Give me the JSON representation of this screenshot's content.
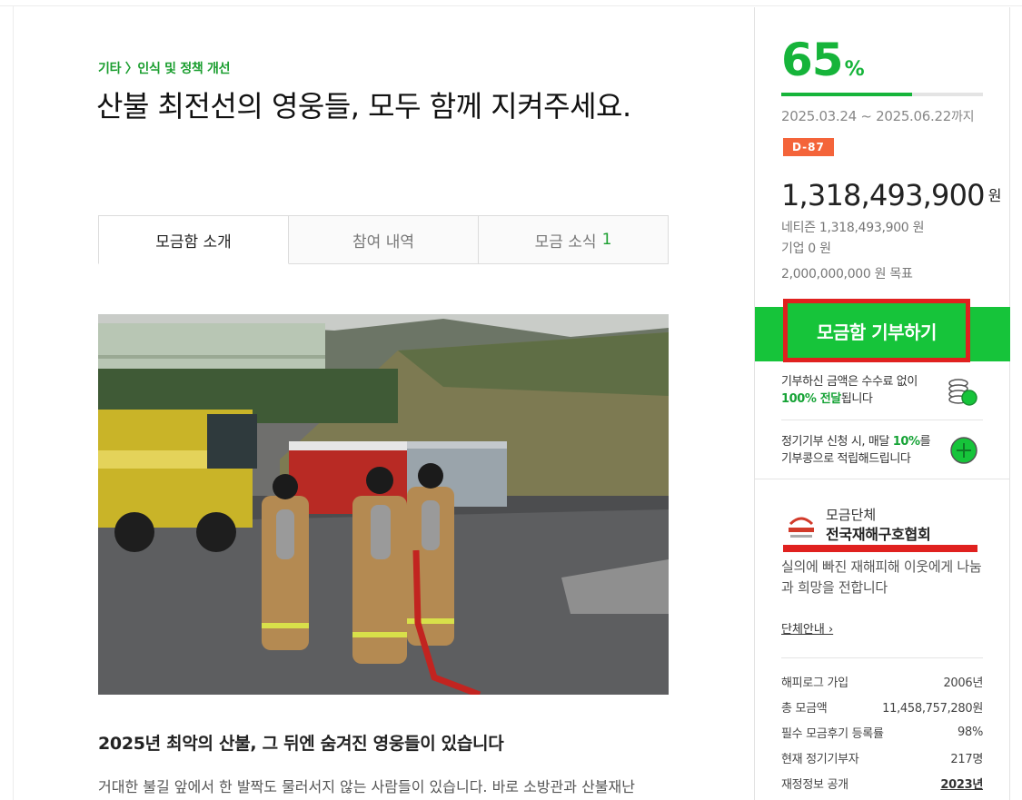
{
  "campaign": {
    "category": "기타 〉인식 및 정책 개선",
    "title": "산불 최전선의 영웅들, 모두 함께 지켜주세요."
  },
  "tabs": [
    {
      "label": "모금함 소개",
      "count": ""
    },
    {
      "label": "참여 내역",
      "count": ""
    },
    {
      "label": "모금 소식",
      "count": "1"
    }
  ],
  "article": {
    "heading": "2025년 최악의 산불, 그 뒤엔 숨겨진 영웅들이 있습니다",
    "body": "거대한 불길 앞에서 한 발짝도 물러서지 않는 사람들이 있습니다. 바로 소방관과 산불재난"
  },
  "sidebar": {
    "percent": "65",
    "percent_unit": "%",
    "progress": 0.65,
    "period": "2025.03.24 ~ 2025.06.22",
    "period_suffix": "까지",
    "dday": "D-87",
    "amount": "1,318,493,900",
    "amount_unit": "원",
    "netizen": "네티즌 1,318,493,900 원",
    "company": "기업 0 원",
    "goal": "2,000,000,000 원 목표",
    "donate_label": "모금함 기부하기",
    "fee_line1": "기부하신 금액은 수수료 없이",
    "fee_bold": "100% 전달",
    "fee_line2": "됩니다",
    "regular_line1a": "정기기부 신청 시, 매달 ",
    "regular_bold": "10%",
    "regular_line1b": "를",
    "regular_line2": "기부콩으로 적립해드립니다"
  },
  "org": {
    "label": "모금단체",
    "name": "전국재해구호협회",
    "desc": "실의에 빠진 재해피해 이웃에게 나눔과 희망을 전합니다",
    "link": "단체안내 ›",
    "stats": [
      {
        "label": "해피로그 가입",
        "value": "2006년"
      },
      {
        "label": "총 모금액",
        "value": "11,458,757,280원"
      },
      {
        "label": "필수 모금후기 등록률",
        "value": "98%"
      },
      {
        "label": "현재 정기기부자",
        "value": "217명"
      },
      {
        "label": "재정정보 공개",
        "value": "2023년"
      }
    ]
  },
  "colors": {
    "accent": "#16b43a",
    "button": "#16c43a",
    "highlight": "#e0211f",
    "dday": "#f4643a"
  }
}
